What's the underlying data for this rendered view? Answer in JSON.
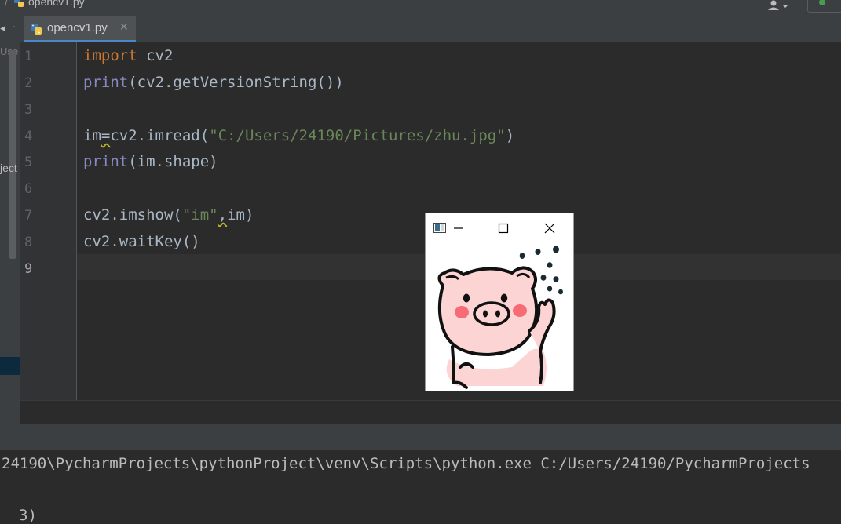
{
  "window": {
    "title": "opencv1.py"
  },
  "tabs": [
    {
      "label": "opencv1.py",
      "active": true
    }
  ],
  "sidebar": {
    "text_top": "Use",
    "text_mid": "ject"
  },
  "editor": {
    "line_numbers": [
      "1",
      "2",
      "3",
      "4",
      "5",
      "6",
      "7",
      "8",
      "9"
    ],
    "current_line": "9",
    "lines": {
      "l1": {
        "keyword": "import",
        "rest": " cv2"
      },
      "l2": {
        "fn": "print",
        "rest": "(cv2.getVersionString())"
      },
      "l4": {
        "var": "im",
        "eq": "=",
        "mid": "cv2.imread(",
        "str": "\"C:/Users/24190/Pictures/zhu.jpg\"",
        "end": ")"
      },
      "l5": {
        "fn": "print",
        "rest": "(im.shape)"
      },
      "l7": {
        "mid": "cv2.imshow(",
        "str": "\"im\"",
        "comma": ",",
        "end": "im)"
      },
      "l8": {
        "text": "cv2.waitKey()"
      }
    }
  },
  "console": {
    "line1": "24190\\PycharmProjects\\pythonProject\\venv\\Scripts\\python.exe C:/Users/24190/PycharmProjects",
    "line2": "3)"
  },
  "image_window": {
    "title_icon": "image-window-icon",
    "buttons": [
      "minimize-icon",
      "maximize-icon",
      "close-icon"
    ],
    "content": "pig-illustration"
  },
  "colors": {
    "keyword": "#cc7832",
    "builtin": "#8888c6",
    "string": "#6a8759",
    "default": "#a9b7c6",
    "background": "#2b2b2b",
    "pig_pink": "#fdd4d4",
    "pig_cheek": "#f76b74"
  }
}
